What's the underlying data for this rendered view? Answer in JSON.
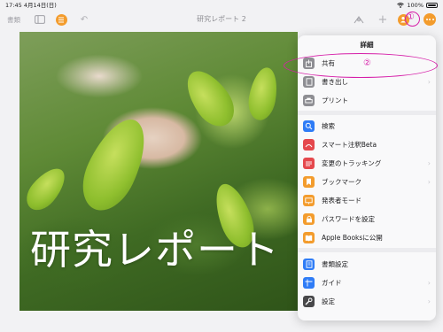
{
  "status_bar": {
    "time": "17:45",
    "date": "4月14日(日)",
    "battery": "100%"
  },
  "toolbar": {
    "documents_label": "書類",
    "doc_title": "研究レポート 2"
  },
  "annotations": {
    "step1": "①",
    "step2": "②"
  },
  "canvas": {
    "title": "研究レポート"
  },
  "menu": {
    "title": "詳細",
    "items": [
      {
        "label": "共有",
        "icon": "share-icon",
        "color": "#8e8e93",
        "chevron": false
      },
      {
        "label": "書き出し",
        "icon": "export-icon",
        "color": "#8e8e93",
        "chevron": true
      },
      {
        "label": "プリント",
        "icon": "print-icon",
        "color": "#8e8e93",
        "chevron": false
      },
      {
        "label": "検索",
        "icon": "search-icon",
        "color": "#2f7cf6",
        "chevron": false
      },
      {
        "label": "スマート注釈Beta",
        "icon": "smart-annotation-icon",
        "color": "#e5484d",
        "chevron": false
      },
      {
        "label": "変更のトラッキング",
        "icon": "track-changes-icon",
        "color": "#e5484d",
        "chevron": true
      },
      {
        "label": "ブックマーク",
        "icon": "bookmark-icon",
        "color": "#f39c2d",
        "chevron": true
      },
      {
        "label": "発表者モード",
        "icon": "presenter-mode-icon",
        "color": "#f39c2d",
        "chevron": false
      },
      {
        "label": "パスワードを設定",
        "icon": "password-icon",
        "color": "#f39c2d",
        "chevron": false
      },
      {
        "label": "Apple Booksに公開",
        "icon": "apple-books-icon",
        "color": "#f39c2d",
        "chevron": false
      },
      {
        "label": "書類設定",
        "icon": "document-settings-icon",
        "color": "#2f7cf6",
        "chevron": false
      },
      {
        "label": "ガイド",
        "icon": "guides-icon",
        "color": "#2f7cf6",
        "chevron": true
      },
      {
        "label": "設定",
        "icon": "settings-icon",
        "color": "#48484a",
        "chevron": true
      }
    ]
  },
  "colors": {
    "accent": "#f39c2d",
    "annotation": "#d61fa8"
  }
}
